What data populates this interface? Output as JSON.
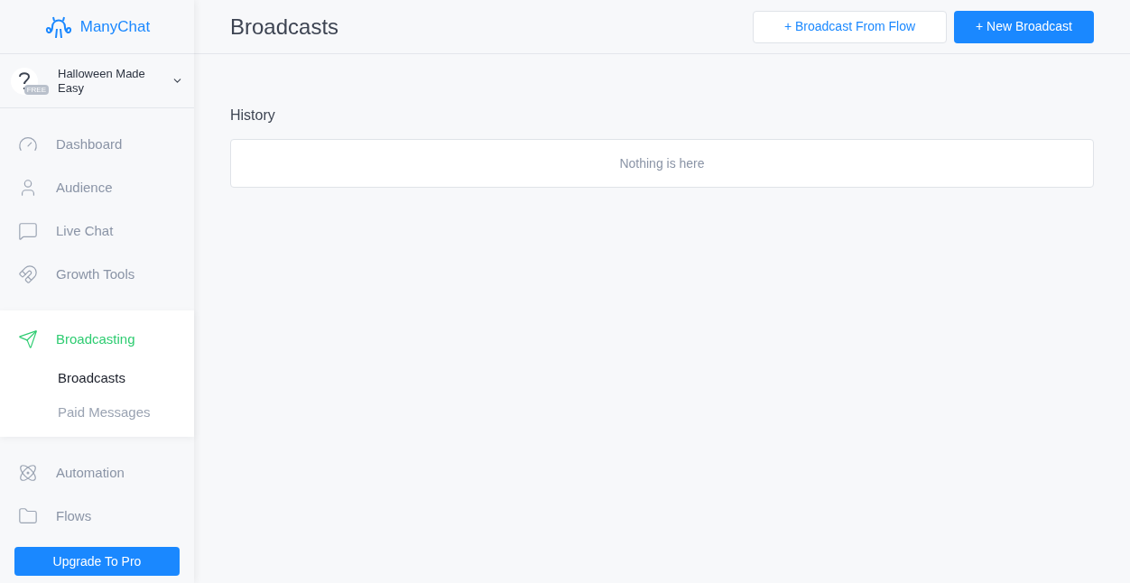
{
  "brand": "ManyChat",
  "account": {
    "name": "Halloween Made Easy",
    "plan": "FREE"
  },
  "nav": [
    {
      "label": "Dashboard",
      "selected": false
    },
    {
      "label": "Audience",
      "selected": false
    },
    {
      "label": "Live Chat",
      "selected": false
    },
    {
      "label": "Growth Tools",
      "selected": false
    },
    {
      "label": "Broadcasting",
      "selected": true,
      "expanded": true,
      "children": [
        {
          "label": "Broadcasts",
          "selected": true
        },
        {
          "label": "Paid Messages",
          "selected": false
        }
      ]
    },
    {
      "label": "Automation",
      "selected": false
    },
    {
      "label": "Flows",
      "selected": false
    }
  ],
  "upgrade_button": "Upgrade To Pro",
  "page_title": "Broadcasts",
  "actions": [
    {
      "label": "+ Broadcast From Flow",
      "kind": "secondary"
    },
    {
      "label": "+ New Broadcast",
      "kind": "primary"
    }
  ],
  "history": {
    "title": "History",
    "empty_text": "Nothing is here"
  }
}
